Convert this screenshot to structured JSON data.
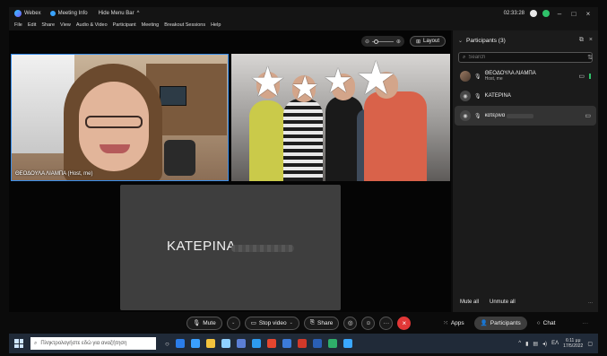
{
  "titlebar": {
    "app": "Webex",
    "meeting_info": "Meeting Info",
    "hide_menu": "Hide Menu Bar",
    "hide_menu_chevron": "^",
    "time": "02:33:28",
    "minimize": "–",
    "maximize": "□",
    "close": "×"
  },
  "menubar": [
    "File",
    "Edit",
    "Share",
    "View",
    "Audio & Video",
    "Participant",
    "Meeting",
    "Breakout Sessions",
    "Help"
  ],
  "stage": {
    "layout_label": "Layout",
    "zoom_icon_left": "⊖",
    "zoom_icon_right": "⊕",
    "video1_name": "ΘΕΟΔΟΥΛΑ ΛΙΑΜΠΑ (Host, me)",
    "video3_name": "ΚΑΤΕΡΙΝΑ"
  },
  "panel": {
    "title": "Participants (3)",
    "search_placeholder": "Search",
    "participants": [
      {
        "name": "ΘΕΟΔΟΥΛΑ ΛΙΑΜΠΑ",
        "sub": "Host, me"
      },
      {
        "name": "ΚΑΤΕΡΙΝΑ",
        "sub": ""
      },
      {
        "name": "κατερινα",
        "sub": ""
      }
    ],
    "mute_all": "Mute all",
    "unmute_all": "Unmute all",
    "more": "..."
  },
  "controls": {
    "mute": "Mute",
    "stop_video": "Stop video",
    "share": "Share",
    "apps": "Apps",
    "participants": "Participants",
    "chat": "Chat",
    "more": "···",
    "end": "×"
  },
  "taskbar": {
    "search_placeholder": "Πληκτρολογήστε εδώ για αναζήτηση",
    "lang": "ΕΛ",
    "time": "6:11 μμ",
    "date": "17/5/2022"
  },
  "colors": {
    "accent": "#3a8eea",
    "end_call": "#e23737",
    "presence": "#2fc26a"
  }
}
